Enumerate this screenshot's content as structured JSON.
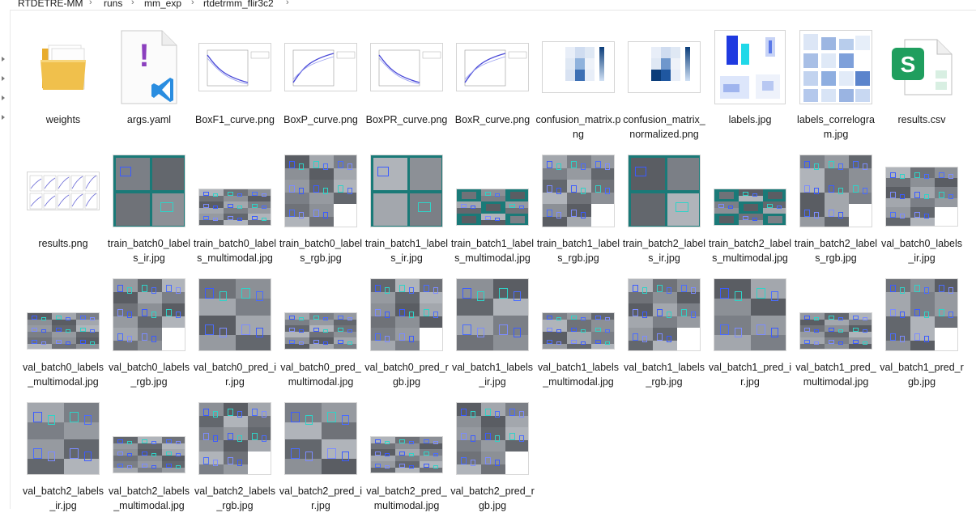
{
  "breadcrumb": [
    "RTDETRE-MM",
    "runs",
    "mm_exp",
    "rtdetrmm_flir3c2"
  ],
  "files": [
    {
      "name": "weights",
      "icon": "folder-icon",
      "kind": "folder"
    },
    {
      "name": "args.yaml",
      "icon": "vscode-yaml-file-icon",
      "kind": "yaml"
    },
    {
      "name": "BoxF1_curve.png",
      "icon": "curve-plot-thumbnail",
      "kind": "curve"
    },
    {
      "name": "BoxP_curve.png",
      "icon": "curve-plot-thumbnail",
      "kind": "curve"
    },
    {
      "name": "BoxPR_curve.png",
      "icon": "curve-plot-thumbnail",
      "kind": "curve"
    },
    {
      "name": "BoxR_curve.png",
      "icon": "curve-plot-thumbnail",
      "kind": "curve"
    },
    {
      "name": "confusion_matrix.png",
      "icon": "confusion-matrix-thumbnail",
      "kind": "confusion"
    },
    {
      "name": "confusion_matrix_normalized.png",
      "icon": "confusion-matrix-thumbnail",
      "kind": "confusion"
    },
    {
      "name": "labels.jpg",
      "icon": "labels-plot-thumbnail",
      "kind": "labels"
    },
    {
      "name": "labels_correlogram.jpg",
      "icon": "correlogram-thumbnail",
      "kind": "correlogram"
    },
    {
      "name": "results.csv",
      "icon": "spreadsheet-csv-icon",
      "kind": "csv"
    },
    {
      "name": "results.png",
      "icon": "results-plot-thumbnail",
      "kind": "results"
    },
    {
      "name": "train_batch0_labels_ir.jpg",
      "icon": "image-thumbnail",
      "kind": "photo",
      "style": "grid",
      "teal": true
    },
    {
      "name": "train_batch0_labels_multimodal.jpg",
      "icon": "image-thumbnail",
      "kind": "photo",
      "style": "wide",
      "teal": false
    },
    {
      "name": "train_batch0_labels_rgb.jpg",
      "icon": "image-thumbnail",
      "kind": "photo",
      "style": "grid",
      "teal": false
    },
    {
      "name": "train_batch1_labels_ir.jpg",
      "icon": "image-thumbnail",
      "kind": "photo",
      "style": "grid",
      "teal": true
    },
    {
      "name": "train_batch1_labels_multimodal.jpg",
      "icon": "image-thumbnail",
      "kind": "photo",
      "style": "wide",
      "teal": true
    },
    {
      "name": "train_batch1_labels_rgb.jpg",
      "icon": "image-thumbnail",
      "kind": "photo",
      "style": "grid",
      "teal": false
    },
    {
      "name": "train_batch2_labels_ir.jpg",
      "icon": "image-thumbnail",
      "kind": "photo",
      "style": "grid",
      "teal": true
    },
    {
      "name": "train_batch2_labels_multimodal.jpg",
      "icon": "image-thumbnail",
      "kind": "photo",
      "style": "wide",
      "teal": true
    },
    {
      "name": "train_batch2_labels_rgb.jpg",
      "icon": "image-thumbnail",
      "kind": "photo",
      "style": "grid",
      "teal": false
    },
    {
      "name": "val_batch0_labels_ir.jpg",
      "icon": "image-thumbnail",
      "kind": "photo",
      "style": "mid",
      "teal": false
    },
    {
      "name": "val_batch0_labels_multimodal.jpg",
      "icon": "image-thumbnail",
      "kind": "photo",
      "style": "wide",
      "teal": false
    },
    {
      "name": "val_batch0_labels_rgb.jpg",
      "icon": "image-thumbnail",
      "kind": "photo",
      "style": "grid",
      "teal": false
    },
    {
      "name": "val_batch0_pred_ir.jpg",
      "icon": "image-thumbnail",
      "kind": "photo",
      "style": "grid",
      "teal": false
    },
    {
      "name": "val_batch0_pred_multimodal.jpg",
      "icon": "image-thumbnail",
      "kind": "photo",
      "style": "wide",
      "teal": false
    },
    {
      "name": "val_batch0_pred_rgb.jpg",
      "icon": "image-thumbnail",
      "kind": "photo",
      "style": "grid",
      "teal": false
    },
    {
      "name": "val_batch1_labels_ir.jpg",
      "icon": "image-thumbnail",
      "kind": "photo",
      "style": "grid",
      "teal": false
    },
    {
      "name": "val_batch1_labels_multimodal.jpg",
      "icon": "image-thumbnail",
      "kind": "photo",
      "style": "wide",
      "teal": false
    },
    {
      "name": "val_batch1_labels_rgb.jpg",
      "icon": "image-thumbnail",
      "kind": "photo",
      "style": "grid",
      "teal": false
    },
    {
      "name": "val_batch1_pred_ir.jpg",
      "icon": "image-thumbnail",
      "kind": "photo",
      "style": "grid",
      "teal": false
    },
    {
      "name": "val_batch1_pred_multimodal.jpg",
      "icon": "image-thumbnail",
      "kind": "photo",
      "style": "wide",
      "teal": false
    },
    {
      "name": "val_batch1_pred_rgb.jpg",
      "icon": "image-thumbnail",
      "kind": "photo",
      "style": "grid",
      "teal": false
    },
    {
      "name": "val_batch2_labels_ir.jpg",
      "icon": "image-thumbnail",
      "kind": "photo",
      "style": "grid",
      "teal": false
    },
    {
      "name": "val_batch2_labels_multimodal.jpg",
      "icon": "image-thumbnail",
      "kind": "photo",
      "style": "wide",
      "teal": false
    },
    {
      "name": "val_batch2_labels_rgb.jpg",
      "icon": "image-thumbnail",
      "kind": "photo",
      "style": "grid",
      "teal": false
    },
    {
      "name": "val_batch2_pred_ir.jpg",
      "icon": "image-thumbnail",
      "kind": "photo",
      "style": "grid",
      "teal": false
    },
    {
      "name": "val_batch2_pred_multimodal.jpg",
      "icon": "image-thumbnail",
      "kind": "photo",
      "style": "wide",
      "teal": false
    },
    {
      "name": "val_batch2_pred_rgb.jpg",
      "icon": "image-thumbnail",
      "kind": "photo",
      "style": "grid",
      "teal": false
    }
  ],
  "colors": {
    "folder": "#f0c04c",
    "teal": "#1a7a78",
    "csv_green": "#1f9e5e",
    "vscode_blue": "#2a8de0",
    "yaml_purple": "#8b3fbe",
    "confusion_dark": "#0b3d7a",
    "labels_blue": "#1f3ae0",
    "labels_cyan": "#20d8e8"
  }
}
